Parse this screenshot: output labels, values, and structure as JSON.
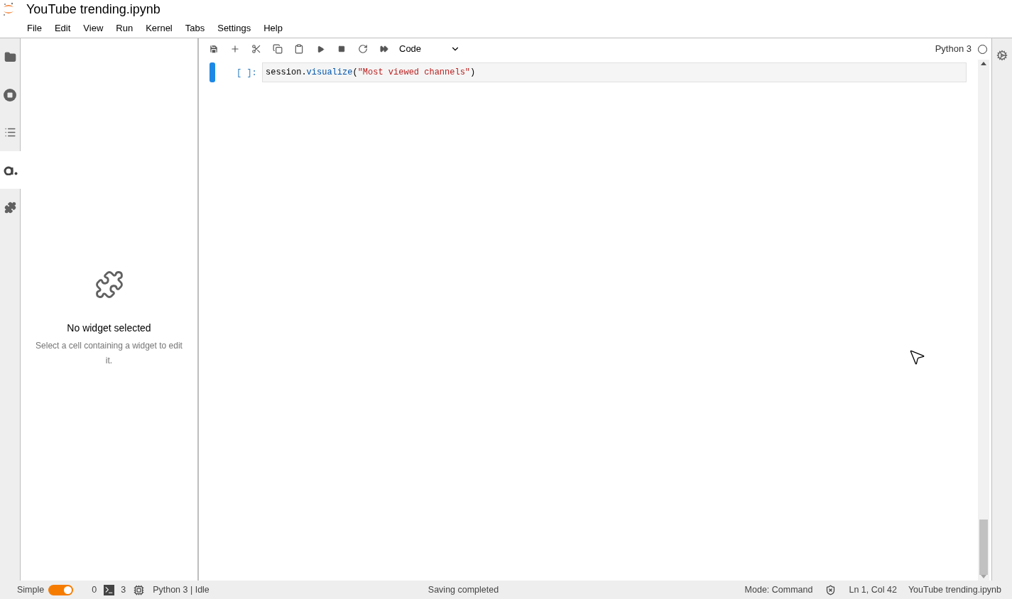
{
  "window": {
    "title": "YouTube trending.ipynb"
  },
  "menu": [
    "File",
    "Edit",
    "View",
    "Run",
    "Kernel",
    "Tabs",
    "Settings",
    "Help"
  ],
  "left_sidebar": [
    {
      "kind": "folder",
      "selected": false
    },
    {
      "kind": "stop",
      "selected": false
    },
    {
      "kind": "list",
      "selected": false
    },
    {
      "kind": "logo",
      "selected": true
    },
    {
      "kind": "puzzle",
      "selected": false
    }
  ],
  "widget_panel": {
    "title": "No widget selected",
    "message": "Select a cell containing a widget to edit it."
  },
  "toolbar": {
    "tools": [
      {
        "kind": "save"
      },
      {
        "kind": "add"
      },
      {
        "kind": "cut"
      },
      {
        "kind": "copy"
      },
      {
        "kind": "paste"
      },
      {
        "kind": "run"
      },
      {
        "kind": "stop"
      },
      {
        "kind": "restart"
      },
      {
        "kind": "run-all"
      }
    ],
    "cell_type": "Code",
    "kernel": "Python 3",
    "kernel_busy": false
  },
  "cells": [
    {
      "prompt": "[ ]:",
      "selected": true,
      "code": [
        {
          "kind": "plain",
          "text": "session."
        },
        {
          "kind": "name",
          "text": "visualize"
        },
        {
          "kind": "plain",
          "text": "("
        },
        {
          "kind": "string",
          "text": "\"Most viewed channels\""
        },
        {
          "kind": "plain",
          "text": ")"
        }
      ]
    }
  ],
  "status_bar": {
    "mode_label": "Simple",
    "simple_on": true,
    "terminals": "0",
    "kernels": "3",
    "kernel_status": "Python 3 | Idle",
    "message": "Saving completed",
    "mode": "Mode: Command",
    "position": "Ln 1, Col 42",
    "file": "YouTube trending.ipynb"
  }
}
